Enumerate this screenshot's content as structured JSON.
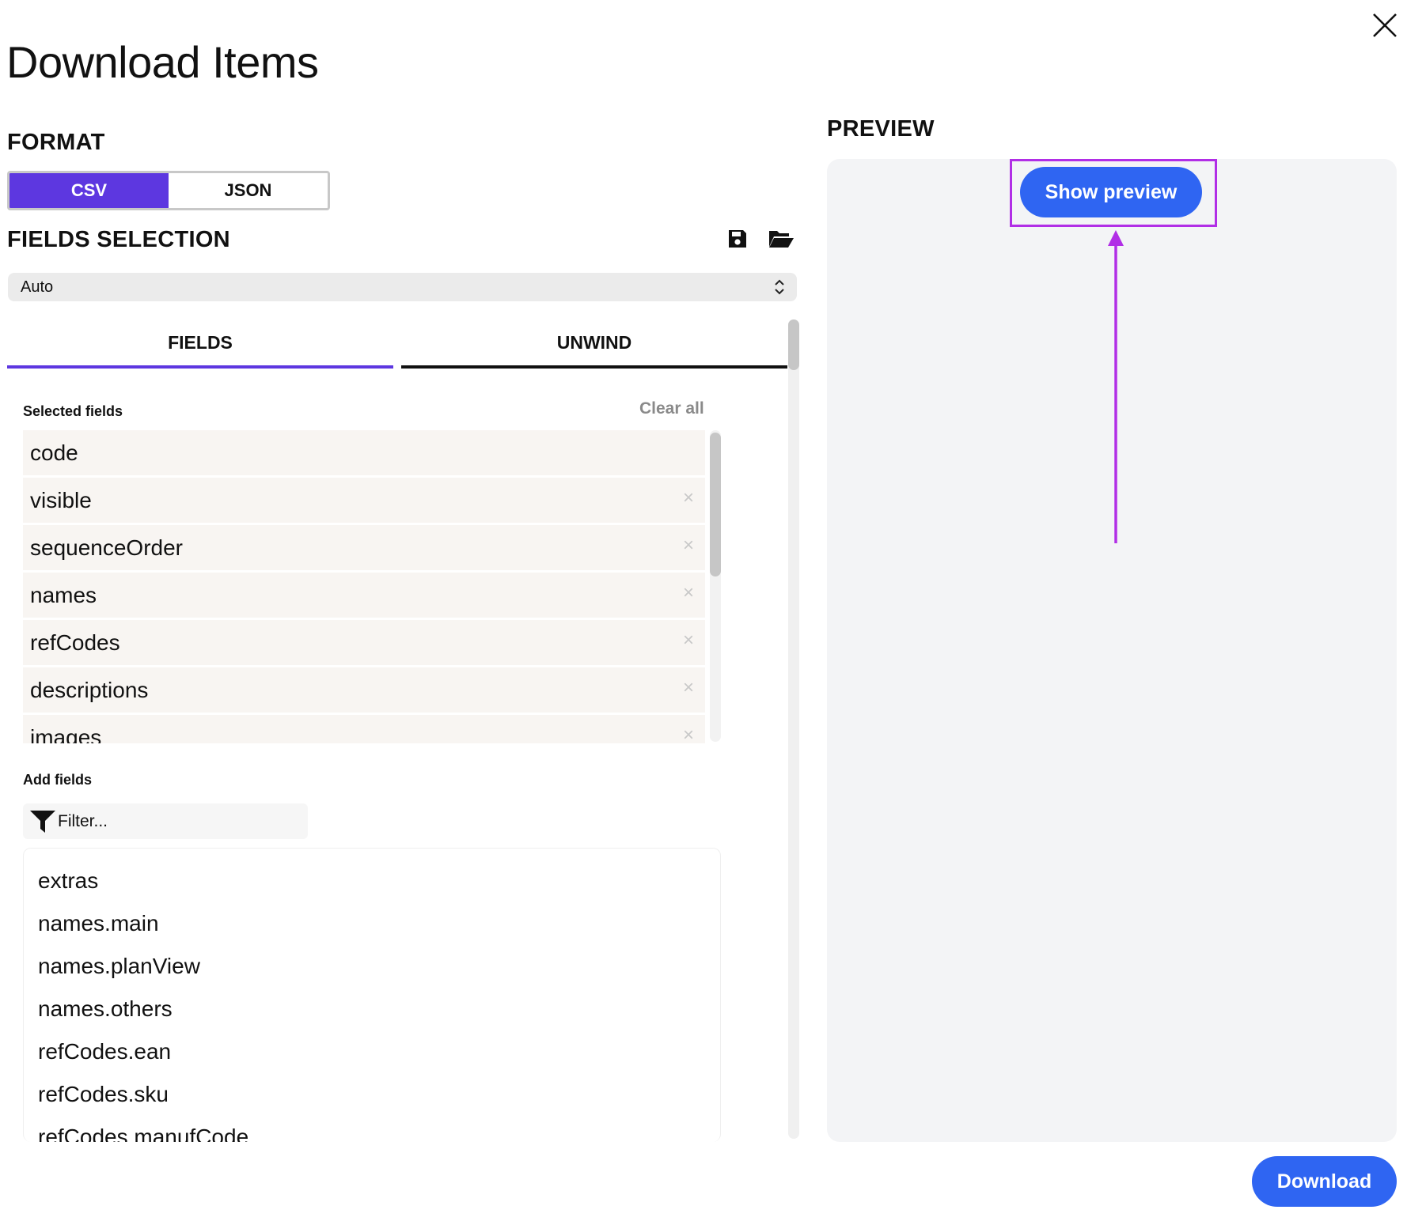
{
  "dialog": {
    "title": "Download Items",
    "close_icon": "close-icon"
  },
  "format": {
    "heading": "FORMAT",
    "options": [
      {
        "label": "CSV",
        "active": true
      },
      {
        "label": "JSON",
        "active": false
      }
    ]
  },
  "fields_selection": {
    "heading": "FIELDS SELECTION",
    "save_icon": "save-icon",
    "open_icon": "folder-open-icon",
    "preset_value": "Auto"
  },
  "tabs": [
    {
      "label": "FIELDS",
      "active": true
    },
    {
      "label": "UNWIND",
      "active": false
    }
  ],
  "selected_fields": {
    "label": "Selected fields",
    "clear_all": "Clear all",
    "items": [
      {
        "name": "code",
        "removable": false
      },
      {
        "name": "visible",
        "removable": true
      },
      {
        "name": "sequenceOrder",
        "removable": true
      },
      {
        "name": "names",
        "removable": true
      },
      {
        "name": "refCodes",
        "removable": true
      },
      {
        "name": "descriptions",
        "removable": true
      },
      {
        "name": "images",
        "removable": true
      }
    ],
    "remove_glyph": "×"
  },
  "add_fields": {
    "label": "Add fields",
    "filter_placeholder": "Filter...",
    "items": [
      "extras",
      "names.main",
      "names.planView",
      "names.others",
      "refCodes.ean",
      "refCodes.sku",
      "refCodes.manufCode"
    ]
  },
  "preview": {
    "heading": "PREVIEW",
    "show_preview_label": "Show preview"
  },
  "footer": {
    "download_label": "Download"
  },
  "colors": {
    "accent_purple": "#5d37e0",
    "primary_blue": "#2f65f2",
    "annotation_magenta": "#b12ee6",
    "preview_bg": "#f3f4f6",
    "selected_item_bg": "#f8f5f2"
  }
}
